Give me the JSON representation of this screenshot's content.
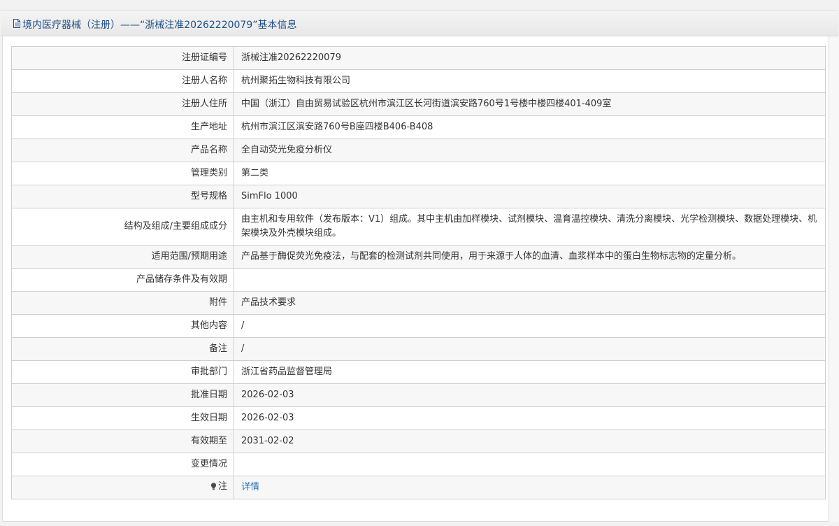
{
  "header": {
    "title": "境内医疗器械（注册）——“浙械注准20262220079”基本信息",
    "icon": "document-icon"
  },
  "rows": [
    {
      "label": "注册证编号",
      "value": "浙械注准20262220079"
    },
    {
      "label": "注册人名称",
      "value": "杭州聚拓生物科技有限公司"
    },
    {
      "label": "注册人住所",
      "value": "中国（浙江）自由贸易试验区杭州市滨江区长河街道滨安路760号1号楼中楼四楼401-409室"
    },
    {
      "label": "生产地址",
      "value": "杭州市滨江区滨安路760号B座四楼B406-B408"
    },
    {
      "label": "产品名称",
      "value": "全自动荧光免疫分析仪"
    },
    {
      "label": "管理类别",
      "value": "第二类"
    },
    {
      "label": "型号规格",
      "value": "SimFlo 1000"
    },
    {
      "label": "结构及组成/主要组成成分",
      "value": "由主机和专用软件（发布版本：V1）组成。其中主机由加样模块、试剂模块、温育温控模块、清洗分离模块、光学检测模块、数据处理模块、机架模块及外壳模块组成。"
    },
    {
      "label": "适用范围/预期用途",
      "value": "产品基于酶促荧光免疫法，与配套的检测试剂共同使用，用于来源于人体的血清、血浆样本中的蛋白生物标志物的定量分析。"
    },
    {
      "label": "产品储存条件及有效期",
      "value": ""
    },
    {
      "label": "附件",
      "value": "产品技术要求"
    },
    {
      "label": "其他内容",
      "value": "/"
    },
    {
      "label": "备注",
      "value": "/"
    },
    {
      "label": "审批部门",
      "value": "浙江省药品监督管理局"
    },
    {
      "label": "批准日期",
      "value": "2026-02-03"
    },
    {
      "label": "生效日期",
      "value": "2026-02-03"
    },
    {
      "label": "有效期至",
      "value": "2031-02-02"
    },
    {
      "label": "变更情况",
      "value": ""
    }
  ],
  "note": {
    "label": "注",
    "icon": "lightbulb-icon",
    "link_text": "详情"
  },
  "colors": {
    "title": "#1f4e89",
    "link": "#2a6eb8",
    "border": "#cfcfcf",
    "row_alt": "#f7f7f7"
  }
}
